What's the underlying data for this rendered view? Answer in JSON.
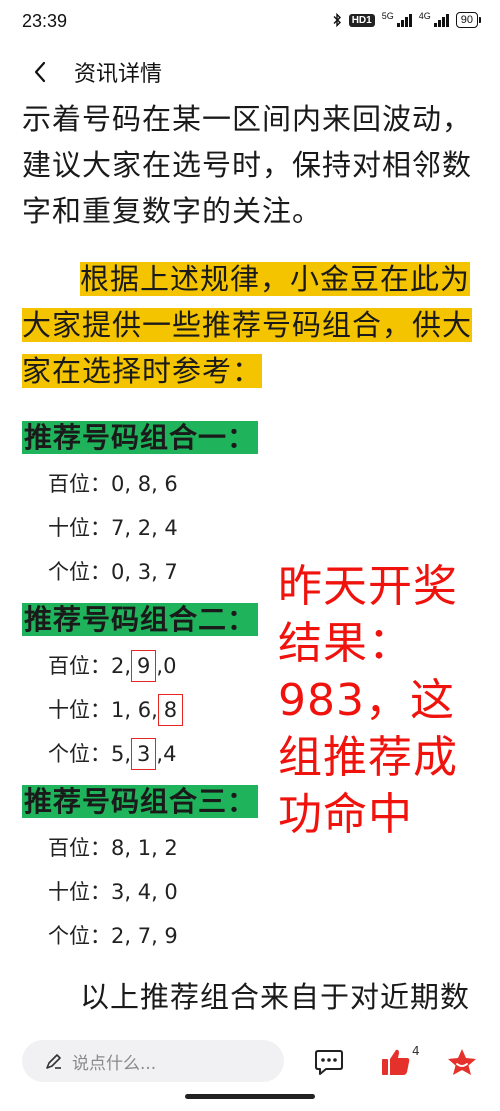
{
  "status": {
    "time": "23:39",
    "hd": "HD1",
    "net1": "5G",
    "net2": "4G",
    "battery": "90"
  },
  "header": {
    "back_icon": "chevron-left-icon",
    "title": "资讯详情"
  },
  "article": {
    "para1": [
      "示着号码在某一区间内来回波动，",
      "建议大家在选号时，保持对相邻数",
      "字和重复数字的关注。"
    ],
    "para2": [
      "根据上述规律，小金豆在此为",
      "大家提供一些推荐号码组合，供大",
      "家在选择时参考："
    ],
    "groups": [
      {
        "title": "推荐号码组合一：",
        "rows": [
          {
            "label": "百位：",
            "values": "0, 8, 6"
          },
          {
            "label": "十位：",
            "values": "7, 2, 4"
          },
          {
            "label": "个位：",
            "values": "0, 3, 7"
          }
        ]
      },
      {
        "title": "推荐号码组合二：",
        "rows": [
          {
            "label": "百位：",
            "pre": "2,",
            "boxed": "9",
            "post": ",0"
          },
          {
            "label": "十位：",
            "pre": "1, 6,",
            "boxed": "8",
            "post": ""
          },
          {
            "label": "个位：",
            "pre": "5,",
            "boxed": "3",
            "post": ",4"
          }
        ]
      },
      {
        "title": "推荐号码组合三：",
        "rows": [
          {
            "label": "百位：",
            "values": "8, 1, 2"
          },
          {
            "label": "十位：",
            "values": "3, 4, 0"
          },
          {
            "label": "个位：",
            "values": "2, 7, 9"
          }
        ]
      }
    ],
    "para3": [
      "以上推荐组合来自于对近期数"
    ],
    "overlay": [
      "昨天开奖",
      "结果：",
      "983，这",
      "组推荐成",
      "功命中"
    ]
  },
  "bottom_bar": {
    "comment_placeholder": "说点什么...",
    "like_count": "4",
    "icons": [
      "pen-icon",
      "comment-icon",
      "thumbs-up-icon",
      "star-icon"
    ],
    "accent_color": "#e5312b"
  },
  "colors": {
    "highlight_yellow": "#f5c400",
    "highlight_green": "#1fb35b",
    "annotation_red": "#f0120d"
  }
}
